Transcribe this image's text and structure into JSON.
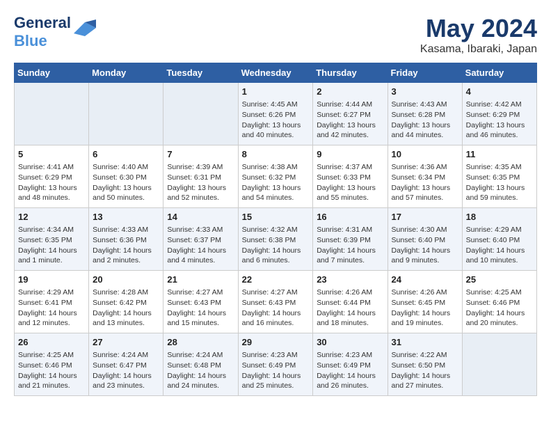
{
  "header": {
    "logo_line1": "General",
    "logo_line2": "Blue",
    "month": "May 2024",
    "location": "Kasama, Ibaraki, Japan"
  },
  "days_of_week": [
    "Sunday",
    "Monday",
    "Tuesday",
    "Wednesday",
    "Thursday",
    "Friday",
    "Saturday"
  ],
  "weeks": [
    [
      {
        "day": "",
        "sunrise": "",
        "sunset": "",
        "daylight": "",
        "empty": true
      },
      {
        "day": "",
        "sunrise": "",
        "sunset": "",
        "daylight": "",
        "empty": true
      },
      {
        "day": "",
        "sunrise": "",
        "sunset": "",
        "daylight": "",
        "empty": true
      },
      {
        "day": "1",
        "sunrise": "Sunrise: 4:45 AM",
        "sunset": "Sunset: 6:26 PM",
        "daylight": "Daylight: 13 hours and 40 minutes."
      },
      {
        "day": "2",
        "sunrise": "Sunrise: 4:44 AM",
        "sunset": "Sunset: 6:27 PM",
        "daylight": "Daylight: 13 hours and 42 minutes."
      },
      {
        "day": "3",
        "sunrise": "Sunrise: 4:43 AM",
        "sunset": "Sunset: 6:28 PM",
        "daylight": "Daylight: 13 hours and 44 minutes."
      },
      {
        "day": "4",
        "sunrise": "Sunrise: 4:42 AM",
        "sunset": "Sunset: 6:29 PM",
        "daylight": "Daylight: 13 hours and 46 minutes."
      }
    ],
    [
      {
        "day": "5",
        "sunrise": "Sunrise: 4:41 AM",
        "sunset": "Sunset: 6:29 PM",
        "daylight": "Daylight: 13 hours and 48 minutes."
      },
      {
        "day": "6",
        "sunrise": "Sunrise: 4:40 AM",
        "sunset": "Sunset: 6:30 PM",
        "daylight": "Daylight: 13 hours and 50 minutes."
      },
      {
        "day": "7",
        "sunrise": "Sunrise: 4:39 AM",
        "sunset": "Sunset: 6:31 PM",
        "daylight": "Daylight: 13 hours and 52 minutes."
      },
      {
        "day": "8",
        "sunrise": "Sunrise: 4:38 AM",
        "sunset": "Sunset: 6:32 PM",
        "daylight": "Daylight: 13 hours and 54 minutes."
      },
      {
        "day": "9",
        "sunrise": "Sunrise: 4:37 AM",
        "sunset": "Sunset: 6:33 PM",
        "daylight": "Daylight: 13 hours and 55 minutes."
      },
      {
        "day": "10",
        "sunrise": "Sunrise: 4:36 AM",
        "sunset": "Sunset: 6:34 PM",
        "daylight": "Daylight: 13 hours and 57 minutes."
      },
      {
        "day": "11",
        "sunrise": "Sunrise: 4:35 AM",
        "sunset": "Sunset: 6:35 PM",
        "daylight": "Daylight: 13 hours and 59 minutes."
      }
    ],
    [
      {
        "day": "12",
        "sunrise": "Sunrise: 4:34 AM",
        "sunset": "Sunset: 6:35 PM",
        "daylight": "Daylight: 14 hours and 1 minute."
      },
      {
        "day": "13",
        "sunrise": "Sunrise: 4:33 AM",
        "sunset": "Sunset: 6:36 PM",
        "daylight": "Daylight: 14 hours and 2 minutes."
      },
      {
        "day": "14",
        "sunrise": "Sunrise: 4:33 AM",
        "sunset": "Sunset: 6:37 PM",
        "daylight": "Daylight: 14 hours and 4 minutes."
      },
      {
        "day": "15",
        "sunrise": "Sunrise: 4:32 AM",
        "sunset": "Sunset: 6:38 PM",
        "daylight": "Daylight: 14 hours and 6 minutes."
      },
      {
        "day": "16",
        "sunrise": "Sunrise: 4:31 AM",
        "sunset": "Sunset: 6:39 PM",
        "daylight": "Daylight: 14 hours and 7 minutes."
      },
      {
        "day": "17",
        "sunrise": "Sunrise: 4:30 AM",
        "sunset": "Sunset: 6:40 PM",
        "daylight": "Daylight: 14 hours and 9 minutes."
      },
      {
        "day": "18",
        "sunrise": "Sunrise: 4:29 AM",
        "sunset": "Sunset: 6:40 PM",
        "daylight": "Daylight: 14 hours and 10 minutes."
      }
    ],
    [
      {
        "day": "19",
        "sunrise": "Sunrise: 4:29 AM",
        "sunset": "Sunset: 6:41 PM",
        "daylight": "Daylight: 14 hours and 12 minutes."
      },
      {
        "day": "20",
        "sunrise": "Sunrise: 4:28 AM",
        "sunset": "Sunset: 6:42 PM",
        "daylight": "Daylight: 14 hours and 13 minutes."
      },
      {
        "day": "21",
        "sunrise": "Sunrise: 4:27 AM",
        "sunset": "Sunset: 6:43 PM",
        "daylight": "Daylight: 14 hours and 15 minutes."
      },
      {
        "day": "22",
        "sunrise": "Sunrise: 4:27 AM",
        "sunset": "Sunset: 6:43 PM",
        "daylight": "Daylight: 14 hours and 16 minutes."
      },
      {
        "day": "23",
        "sunrise": "Sunrise: 4:26 AM",
        "sunset": "Sunset: 6:44 PM",
        "daylight": "Daylight: 14 hours and 18 minutes."
      },
      {
        "day": "24",
        "sunrise": "Sunrise: 4:26 AM",
        "sunset": "Sunset: 6:45 PM",
        "daylight": "Daylight: 14 hours and 19 minutes."
      },
      {
        "day": "25",
        "sunrise": "Sunrise: 4:25 AM",
        "sunset": "Sunset: 6:46 PM",
        "daylight": "Daylight: 14 hours and 20 minutes."
      }
    ],
    [
      {
        "day": "26",
        "sunrise": "Sunrise: 4:25 AM",
        "sunset": "Sunset: 6:46 PM",
        "daylight": "Daylight: 14 hours and 21 minutes."
      },
      {
        "day": "27",
        "sunrise": "Sunrise: 4:24 AM",
        "sunset": "Sunset: 6:47 PM",
        "daylight": "Daylight: 14 hours and 23 minutes."
      },
      {
        "day": "28",
        "sunrise": "Sunrise: 4:24 AM",
        "sunset": "Sunset: 6:48 PM",
        "daylight": "Daylight: 14 hours and 24 minutes."
      },
      {
        "day": "29",
        "sunrise": "Sunrise: 4:23 AM",
        "sunset": "Sunset: 6:49 PM",
        "daylight": "Daylight: 14 hours and 25 minutes."
      },
      {
        "day": "30",
        "sunrise": "Sunrise: 4:23 AM",
        "sunset": "Sunset: 6:49 PM",
        "daylight": "Daylight: 14 hours and 26 minutes."
      },
      {
        "day": "31",
        "sunrise": "Sunrise: 4:22 AM",
        "sunset": "Sunset: 6:50 PM",
        "daylight": "Daylight: 14 hours and 27 minutes."
      },
      {
        "day": "",
        "sunrise": "",
        "sunset": "",
        "daylight": "",
        "empty": true
      }
    ]
  ]
}
